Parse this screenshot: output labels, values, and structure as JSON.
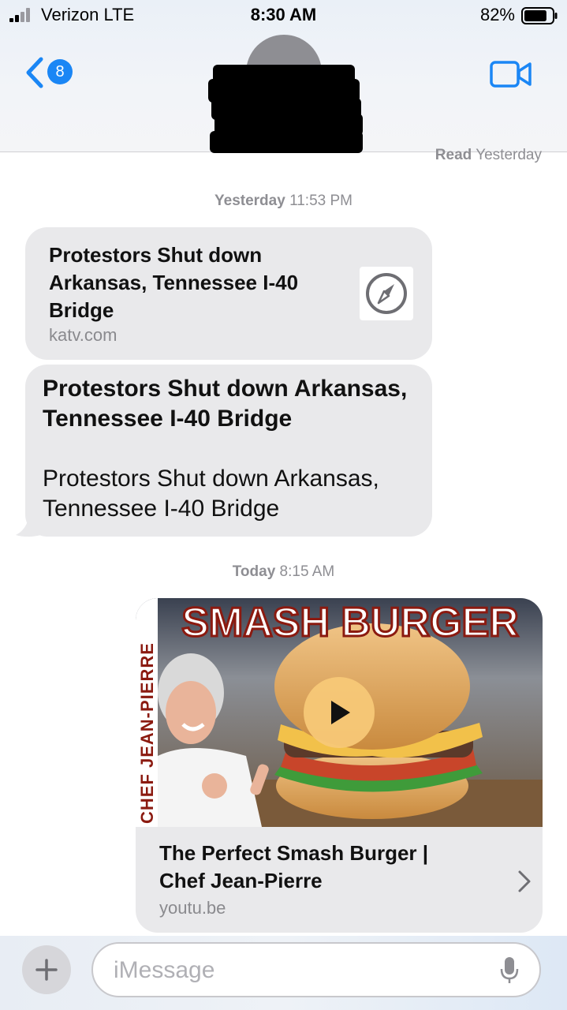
{
  "status_bar": {
    "carrier": "Verizon  LTE",
    "time": "8:30 AM",
    "battery_percent": "82%",
    "battery_level": 0.82,
    "signal_bars": 2
  },
  "nav": {
    "back_badge_count": "8",
    "back_icon": "chevron-left-icon",
    "video_icon": "video-camera-icon",
    "accent_color": "#1a86f5"
  },
  "messages": {
    "read_receipt_bold": "Read",
    "read_receipt_time": "Yesterday",
    "timestamp1_day": "Yesterday",
    "timestamp1_time": "11:53 PM",
    "link_preview1": {
      "title": "Protestors Shut down Arkansas, Tennessee I-40 Bridge",
      "domain": "katv.com",
      "icon": "compass-icon"
    },
    "text_message": {
      "title": "Protestors Shut down Arkansas, Tennessee I-40 Bridge",
      "body": "Protestors Shut down Arkansas, Tennessee I-40 Bridge"
    },
    "timestamp2_day": "Today",
    "timestamp2_time": "8:15 AM",
    "link_preview2": {
      "thumbnail_headline": "SMASH BURGER",
      "thumbnail_side_text": "CHEF JEAN-PIERRE",
      "title": "The Perfect Smash Burger | Chef Jean-Pierre",
      "domain": "youtu.be",
      "play_icon": "play-icon"
    }
  },
  "composer": {
    "placeholder": "iMessage",
    "plus_icon": "plus-icon",
    "mic_icon": "microphone-icon"
  }
}
